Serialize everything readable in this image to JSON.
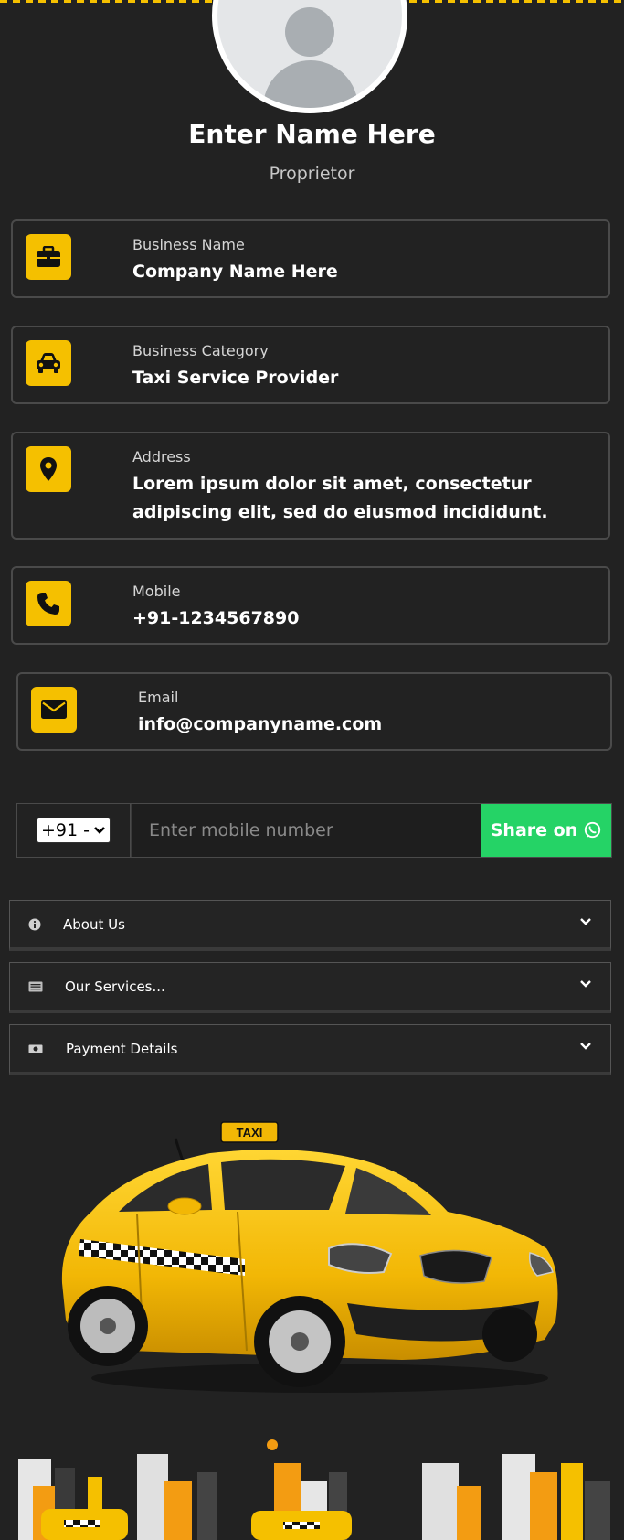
{
  "profile": {
    "name": "Enter Name Here",
    "role": "Proprietor"
  },
  "cards": [
    {
      "icon": "briefcase-icon",
      "label": "Business Name",
      "value": "Company Name Here"
    },
    {
      "icon": "car-icon",
      "label": "Business Category",
      "value": "Taxi Service Provider"
    },
    {
      "icon": "location-pin-icon",
      "label": "Address",
      "value": "Lorem ipsum dolor sit amet, consectetur adipiscing elit, sed do eiusmod incididunt."
    },
    {
      "icon": "phone-icon",
      "label": "Mobile",
      "value": "+91-1234567890"
    },
    {
      "icon": "envelope-icon",
      "label": "Email",
      "value": "info@companyname.com"
    }
  ],
  "share": {
    "country_code": "+91 -",
    "placeholder": "Enter mobile number",
    "button_label": "Share on"
  },
  "accordion": [
    {
      "icon": "info-icon",
      "label": "About Us"
    },
    {
      "icon": "list-icon",
      "label": "Our Services..."
    },
    {
      "icon": "money-icon",
      "label": "Payment Details"
    }
  ],
  "taxi_sign": "TAXI",
  "colors": {
    "accent": "#f5c000",
    "background": "#222222",
    "whatsapp": "#25d366"
  }
}
